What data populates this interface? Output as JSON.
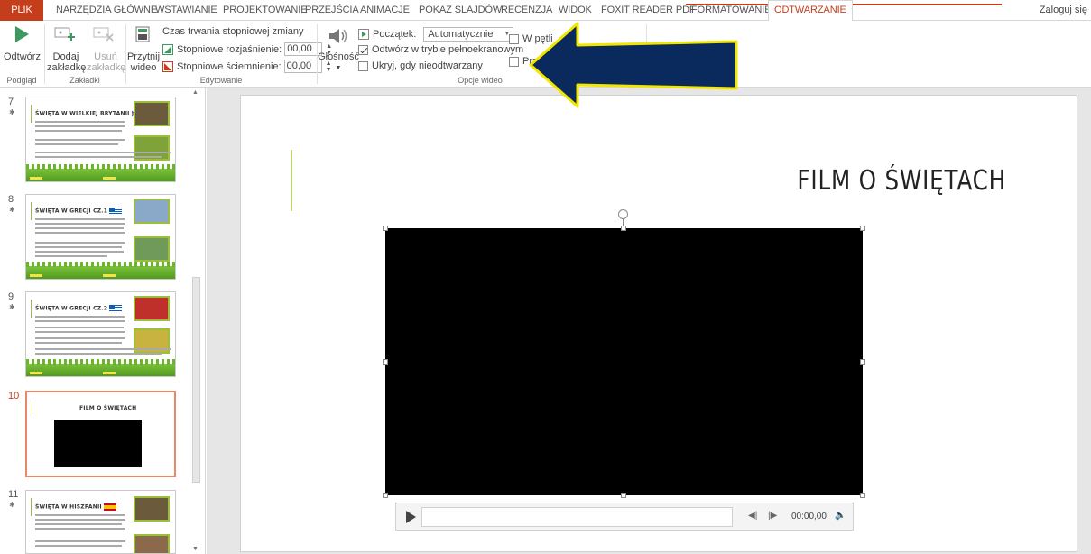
{
  "tabs": {
    "file": "PLIK",
    "home": "NARZĘDZIA GŁÓWNE",
    "insert": "WSTAWIANIE",
    "design": "PROJEKTOWANIE",
    "transitions": "PRZEJŚCIA",
    "animations": "ANIMACJE",
    "slideshow": "POKAZ SLAJDÓW",
    "review": "RECENZJA",
    "view": "WIDOK",
    "foxit": "FOXIT READER PDF",
    "format": "FORMATOWANIE",
    "playback": "ODTWARZANIE"
  },
  "signin": "Zaloguj się",
  "ribbon": {
    "preview": {
      "play": "Odtwórz",
      "group": "Podgląd"
    },
    "bookmarks": {
      "add_line1": "Dodaj",
      "add_line2": "zakładkę",
      "remove_line1": "Usuń",
      "remove_line2": "zakładkę",
      "group": "Zakładki"
    },
    "editing": {
      "trim_line1": "Przytnij",
      "trim_line2": "wideo",
      "fade_duration": "Czas trwania stopniowej zmiany",
      "fade_in_label": "Stopniowe rozjaśnienie:",
      "fade_in_value": "00,00",
      "fade_out_label": "Stopniowe ściemnienie:",
      "fade_out_value": "00,00",
      "group": "Edytowanie"
    },
    "video_options": {
      "volume": "Głośność",
      "start_label": "Początek:",
      "start_value": "Automatycznie",
      "fullscreen": "Odtwórz w trybie pełnoekranowym",
      "fullscreen_checked": true,
      "hide": "Ukryj, gdy nieodtwarzany",
      "loop": "W pętli",
      "rewind": "Prz",
      "group": "Opcje wideo"
    }
  },
  "thumbnails": [
    {
      "num": "7",
      "title": "ŚWIĘTA W WIELKIEJ BRYTANII",
      "flag": "uk"
    },
    {
      "num": "8",
      "title": "ŚWIĘTA W GRECJI CZ.1",
      "flag": "gr"
    },
    {
      "num": "9",
      "title": "ŚWIĘTA W GRECJI CZ.2",
      "flag": "gr"
    },
    {
      "num": "10",
      "title": "FILM O ŚWIĘTACH",
      "flag": ""
    },
    {
      "num": "11",
      "title": "ŚWIĘTA W HISZPANII",
      "flag": "es"
    }
  ],
  "slide": {
    "title": "FILM O ŚWIĘTACH"
  },
  "player": {
    "time": "00:00,00"
  },
  "colors": {
    "accent": "#c43e1c",
    "arrow_fill": "#0a2a5e",
    "arrow_stroke": "#f2e600"
  }
}
